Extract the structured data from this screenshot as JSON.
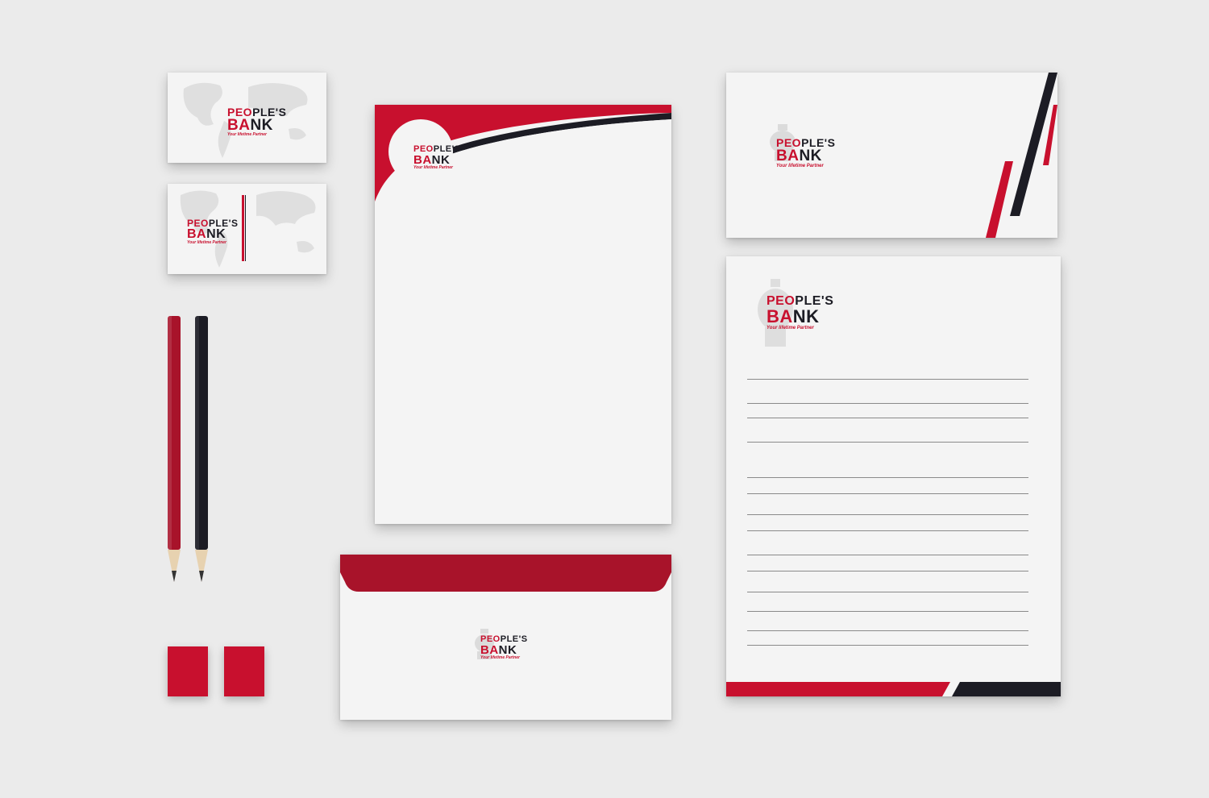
{
  "brand": {
    "name_part1_red": "PEO",
    "name_part1_dark": "PLE'S",
    "name_part2_red": "BA",
    "name_part2_dark": "NK",
    "tagline": "Your lifetime Partner"
  },
  "colors": {
    "red": "#c8102e",
    "maroon": "#a8132a",
    "dark": "#1c1c24"
  },
  "icons": {
    "piggy_bank": "piggy-bank-icon",
    "world_map": "world-map-icon"
  },
  "items": {
    "business_card_front": "business-card",
    "business_card_back": "business-card",
    "letterhead": "letterhead",
    "envelope_dl_top": "envelope",
    "envelope_dl_bottom": "envelope",
    "notepad": "notepad",
    "pencils": [
      "red",
      "black"
    ],
    "swatches": [
      "red",
      "red"
    ]
  }
}
